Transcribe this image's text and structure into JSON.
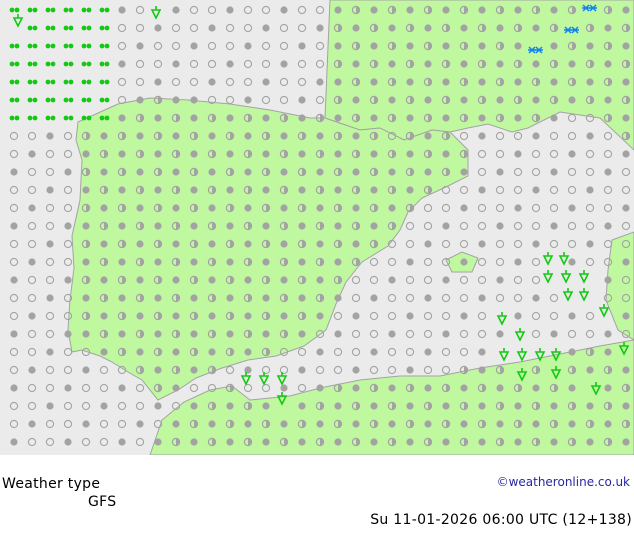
{
  "footer": {
    "label": "Weather type",
    "model": "GFS",
    "datetime": "Su 11-01-2026 06:00 UTC (12+138)",
    "credit": "©weatheronline.co.uk"
  },
  "colors": {
    "sea": "#ebebeb",
    "land": "#c0f8a0",
    "coast": "#a3a3a3",
    "cloud_marker": "#a3a3a3",
    "rain_marker": "#14c814",
    "snow_marker": "#1482e8",
    "credit_text": "#2828a0"
  },
  "legend_icons": [
    "overcast-icon",
    "partly-cloudy-icon",
    "clear-icon",
    "rain-icon",
    "showers-icon",
    "snow-icon"
  ]
}
